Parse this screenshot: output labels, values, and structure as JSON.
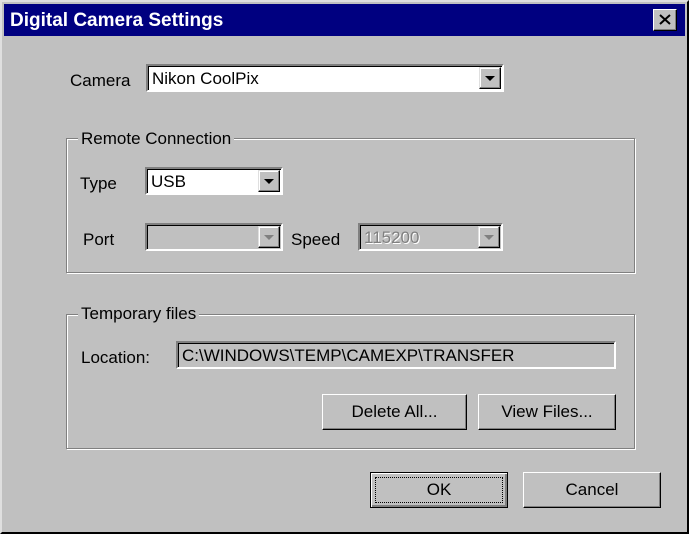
{
  "window": {
    "title": "Digital Camera Settings"
  },
  "camera": {
    "label": "Camera",
    "value": "Nikon CoolPix"
  },
  "remote": {
    "group_title": "Remote Connection",
    "type_label": "Type",
    "type_value": "USB",
    "port_label": "Port",
    "port_value": "",
    "speed_label": "Speed",
    "speed_value": "115200"
  },
  "temp": {
    "group_title": "Temporary files",
    "location_label": "Location:",
    "location_value": "C:\\WINDOWS\\TEMP\\CAMEXP\\TRANSFER",
    "delete_label": "Delete All...",
    "view_label": "View Files..."
  },
  "footer": {
    "ok_label": "OK",
    "cancel_label": "Cancel"
  },
  "colors": {
    "titlebar": "#000080",
    "face": "#c0c0c0"
  },
  "icons": {
    "close": "close-icon",
    "dropdown": "chevron-down-icon"
  }
}
